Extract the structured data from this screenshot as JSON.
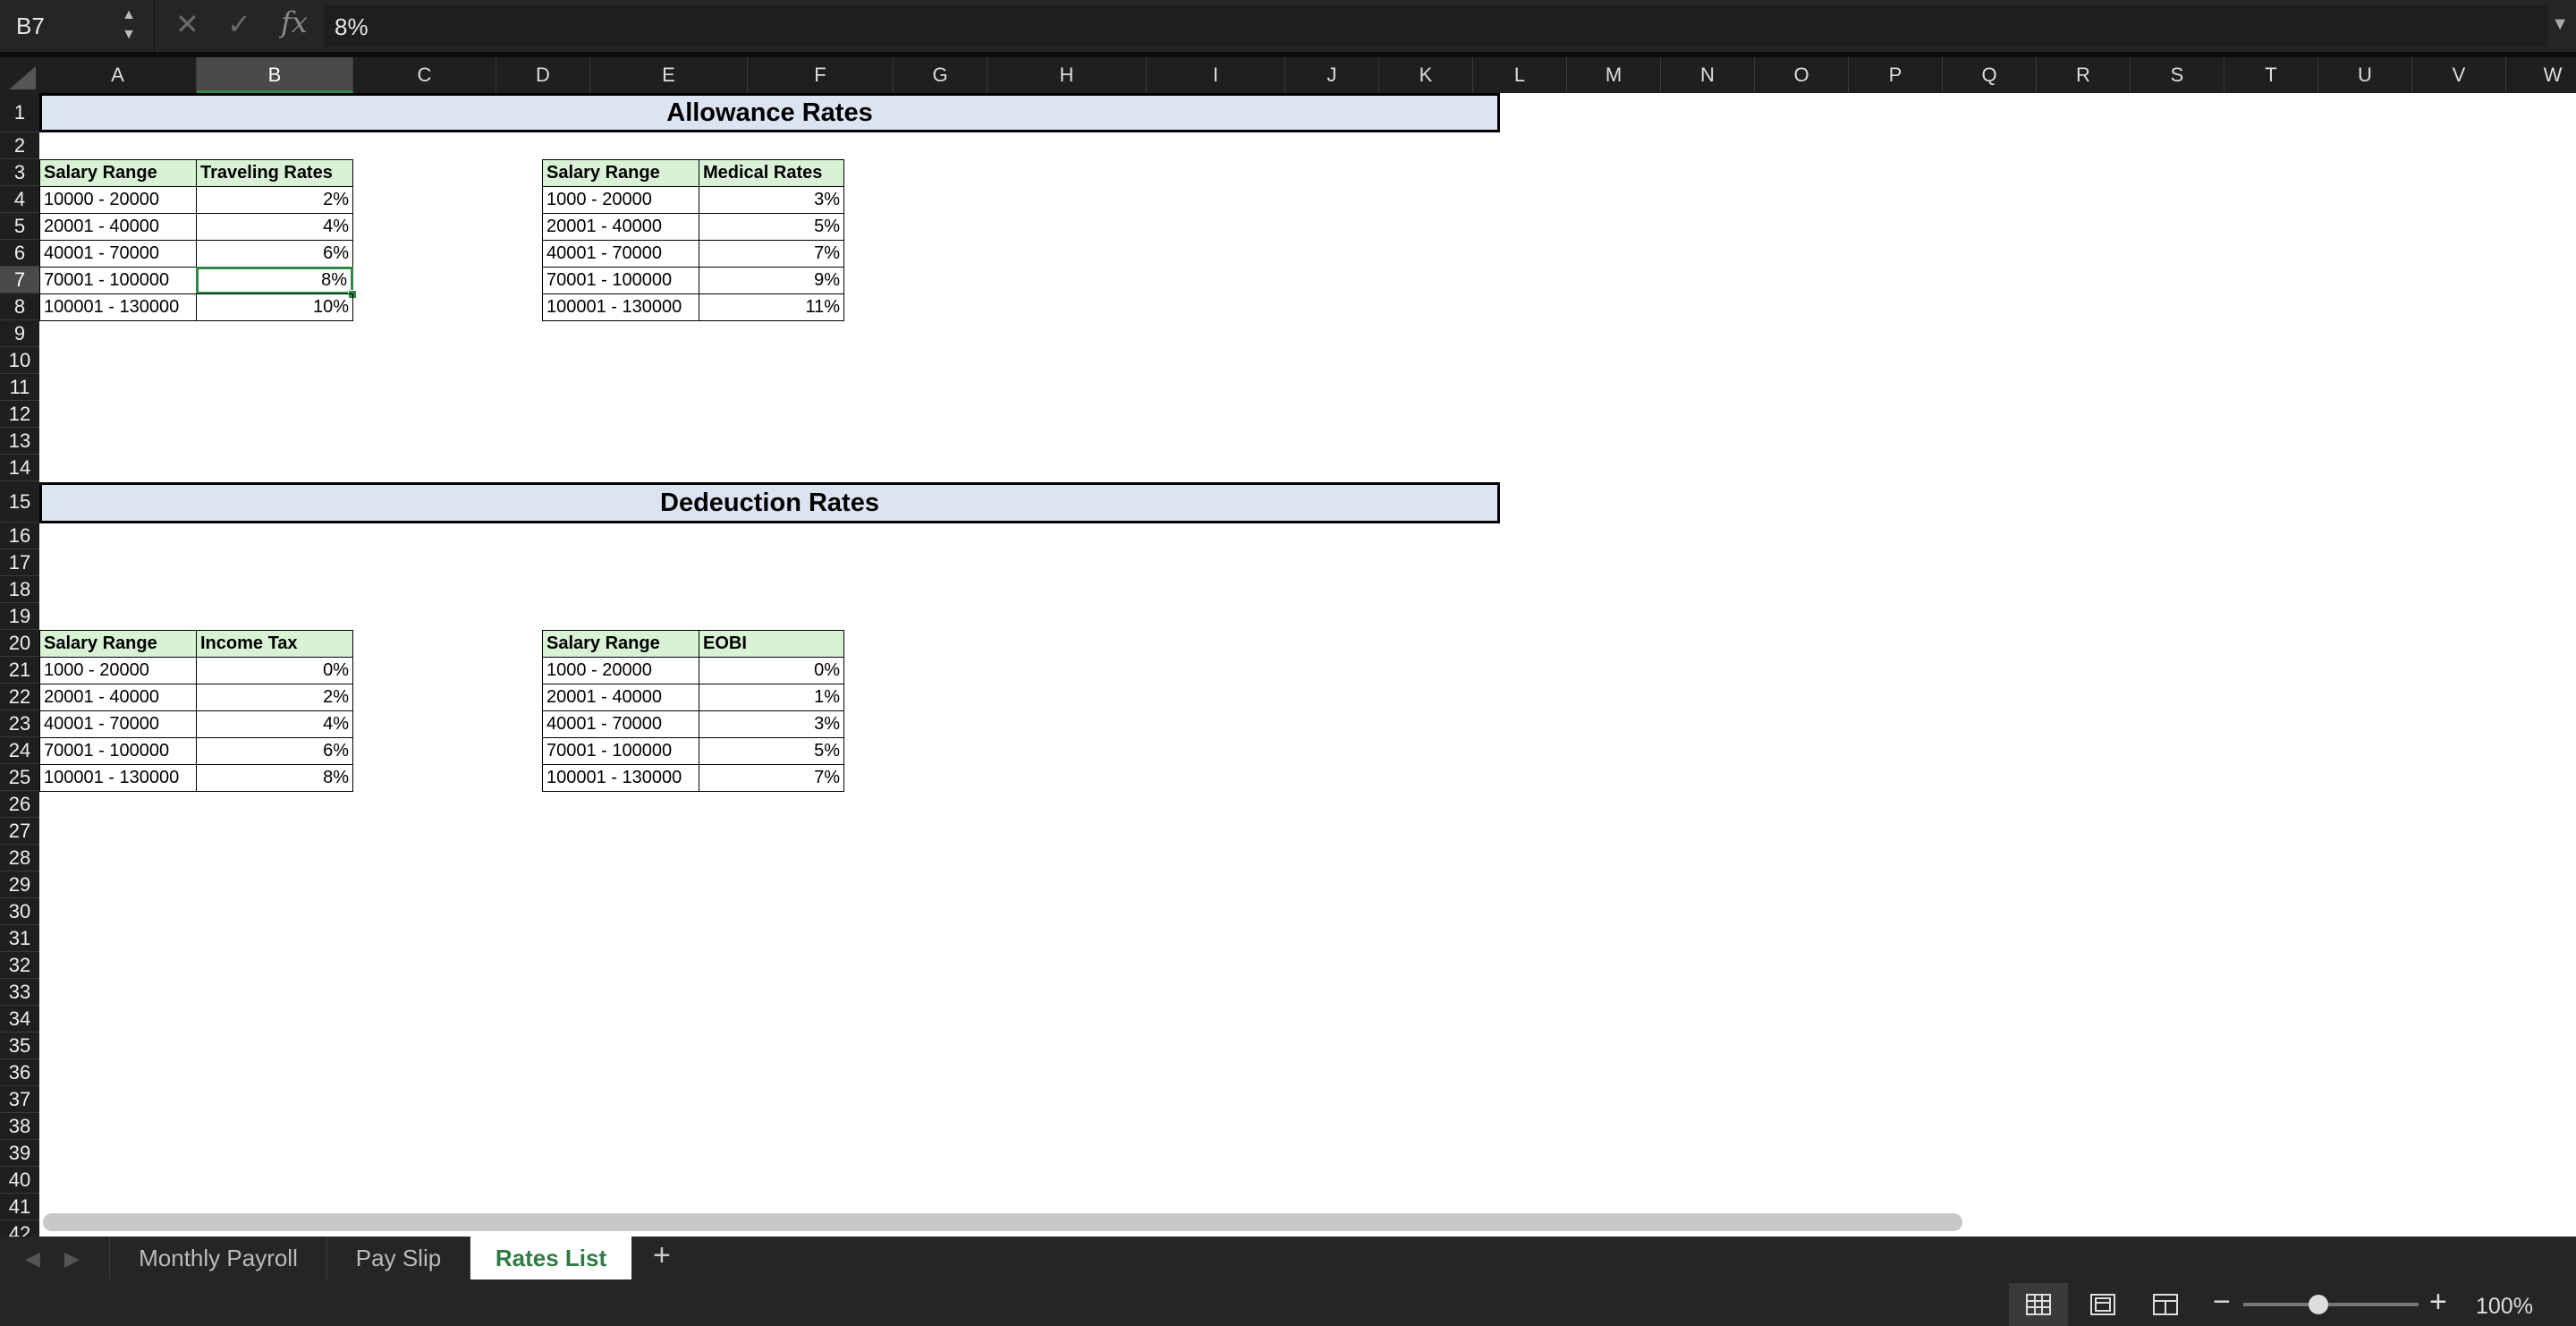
{
  "formula_bar": {
    "cell_ref": "B7",
    "formula": "8%"
  },
  "columns": [
    "A",
    "B",
    "C",
    "D",
    "E",
    "F",
    "G",
    "H",
    "I",
    "J",
    "K",
    "L",
    "M",
    "N",
    "O",
    "P",
    "Q",
    "R",
    "S",
    "T",
    "U",
    "V",
    "W"
  ],
  "selected_column": "B",
  "selected_row": "7",
  "sections": {
    "allowance_title": "Allowance Rates",
    "deduction_title": "Dedeuction Rates"
  },
  "tables": {
    "traveling": {
      "h1": "Salary Range",
      "h2": "Traveling Rates",
      "rows": [
        {
          "range": "10000 - 20000",
          "rate": "2%"
        },
        {
          "range": "20001 - 40000",
          "rate": "4%"
        },
        {
          "range": "40001 - 70000",
          "rate": "6%"
        },
        {
          "range": "70001 - 100000",
          "rate": "8%"
        },
        {
          "range": "100001 - 130000",
          "rate": "10%"
        }
      ]
    },
    "medical": {
      "h1": "Salary Range",
      "h2": "Medical Rates",
      "rows": [
        {
          "range": "1000 - 20000",
          "rate": "3%"
        },
        {
          "range": "20001 - 40000",
          "rate": "5%"
        },
        {
          "range": "40001 - 70000",
          "rate": "7%"
        },
        {
          "range": "70001 - 100000",
          "rate": "9%"
        },
        {
          "range": "100001 - 130000",
          "rate": "11%"
        }
      ]
    },
    "income_tax": {
      "h1": "Salary Range",
      "h2": "Income Tax",
      "rows": [
        {
          "range": "1000 - 20000",
          "rate": "0%"
        },
        {
          "range": "20001 - 40000",
          "rate": "2%"
        },
        {
          "range": "40001 - 70000",
          "rate": "4%"
        },
        {
          "range": "70001 - 100000",
          "rate": "6%"
        },
        {
          "range": "100001 - 130000",
          "rate": "8%"
        }
      ]
    },
    "eobi": {
      "h1": "Salary Range",
      "h2": "EOBI",
      "rows": [
        {
          "range": "1000 - 20000",
          "rate": "0%"
        },
        {
          "range": "20001 - 40000",
          "rate": "1%"
        },
        {
          "range": "40001 - 70000",
          "rate": "3%"
        },
        {
          "range": "70001 - 100000",
          "rate": "5%"
        },
        {
          "range": "100001 - 130000",
          "rate": "7%"
        }
      ]
    }
  },
  "sheet_tabs": [
    "Monthly Payroll",
    "Pay Slip",
    "Rates List"
  ],
  "active_tab": "Rates List",
  "zoom": "100%",
  "zoom_level_fraction": 0.43,
  "colors": {
    "accent": "#2f8a48",
    "header_fill": "#d9f2d6",
    "title_fill": "#dce4f1"
  }
}
